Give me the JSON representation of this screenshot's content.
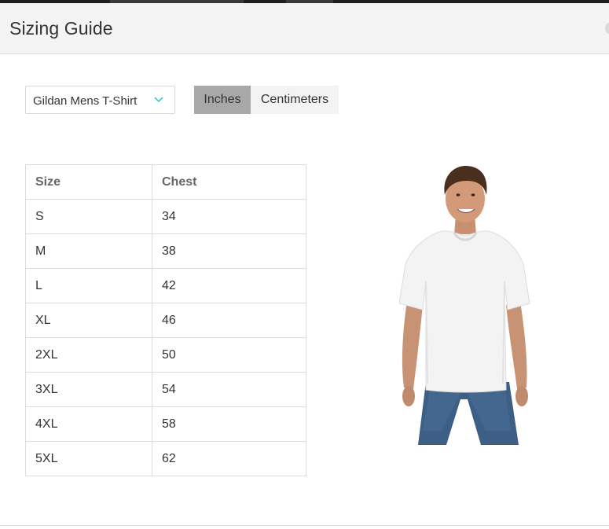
{
  "dialog": {
    "title": "Sizing Guide"
  },
  "product_select": {
    "value": "Gildan Mens T-Shirt"
  },
  "units": {
    "options": [
      "Inches",
      "Centimeters"
    ],
    "selected": "Inches"
  },
  "table": {
    "headers": [
      "Size",
      "Chest"
    ],
    "rows": [
      [
        "S",
        "34"
      ],
      [
        "M",
        "38"
      ],
      [
        "L",
        "42"
      ],
      [
        "XL",
        "46"
      ],
      [
        "2XL",
        "50"
      ],
      [
        "3XL",
        "54"
      ],
      [
        "4XL",
        "58"
      ],
      [
        "5XL",
        "62"
      ]
    ]
  },
  "colors": {
    "header_bg": "#f4f4f4",
    "active_unit_bg": "#a8a8a8",
    "inactive_unit_bg": "#f3f3f3",
    "chevron": "#3cc8c8",
    "border": "#dcdcdc"
  },
  "icons": {
    "dropdown": "chevron-down-icon",
    "close": "close-icon"
  }
}
